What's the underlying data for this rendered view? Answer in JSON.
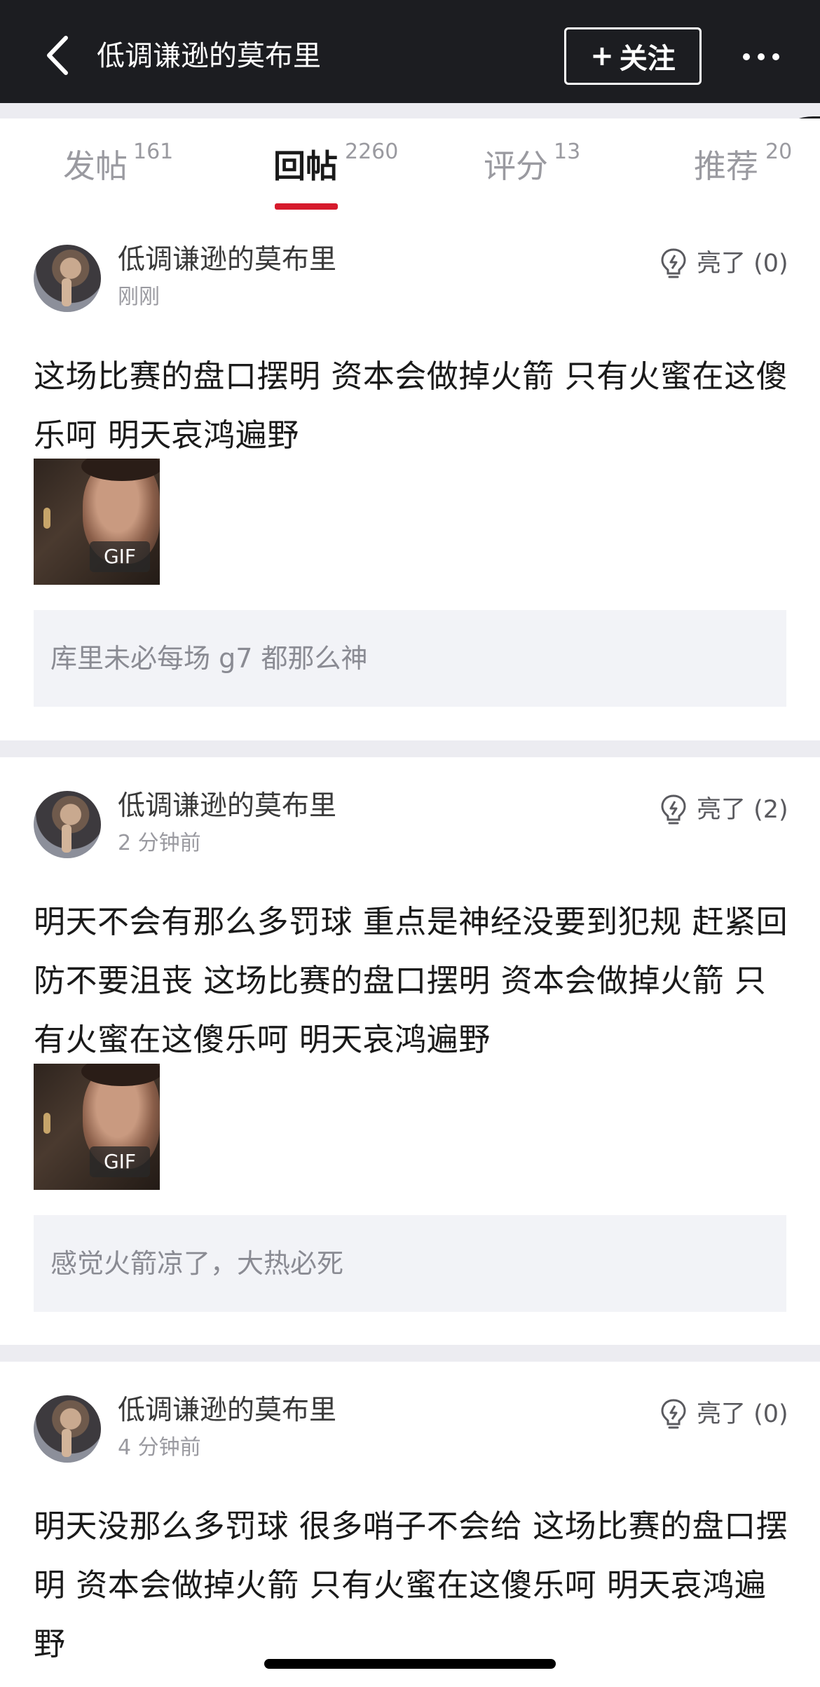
{
  "header": {
    "title": "低调谦逊的莫布里",
    "follow_label": "关注",
    "follow_icon": "plus-icon",
    "back_icon": "chevron-left-icon",
    "more_icon": "more-dots-icon",
    "background": "#1c1d21"
  },
  "tabs": [
    {
      "label": "发帖",
      "count": "161",
      "active": false
    },
    {
      "label": "回帖",
      "count": "2260",
      "active": true
    },
    {
      "label": "评分",
      "count": "13",
      "active": false
    },
    {
      "label": "推荐",
      "count": "20",
      "active": false
    }
  ],
  "accent_color": "#d61a2c",
  "posts": [
    {
      "username": "低调谦逊的莫布里",
      "time": "刚刚",
      "like_label": "亮了 (0)",
      "content": "这场比赛的盘口摆明 资本会做掉火箭 只有火蜜在这傻乐呵 明天哀鸿遍野",
      "gif_label": "GIF",
      "quote": "库里未必每场 g7 都那么神"
    },
    {
      "username": "低调谦逊的莫布里",
      "time": "2 分钟前",
      "like_label": "亮了 (2)",
      "content": "明天不会有那么多罚球 重点是神经没要到犯规 赶紧回防不要沮丧 这场比赛的盘口摆明 资本会做掉火箭 只有火蜜在这傻乐呵 明天哀鸿遍野",
      "gif_label": "GIF",
      "quote": "感觉火箭凉了，大热必死"
    },
    {
      "username": "低调谦逊的莫布里",
      "time": "4 分钟前",
      "like_label": "亮了 (0)",
      "content": "明天没那么多罚球 很多哨子不会给 这场比赛的盘口摆明 资本会做掉火箭 只有火蜜在这傻乐呵 明天哀鸿遍野"
    }
  ]
}
